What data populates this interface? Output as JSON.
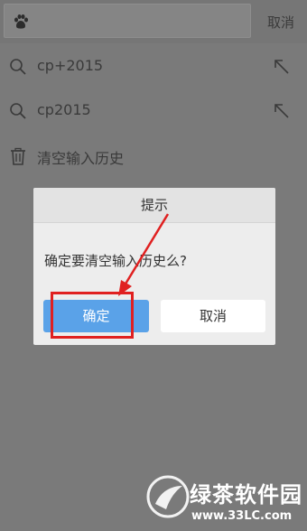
{
  "header": {
    "cancel_label": "取消"
  },
  "history": [
    {
      "text": "cp+2015"
    },
    {
      "text": "cp2015"
    }
  ],
  "clear_history_label": "清空输入历史",
  "dialog": {
    "title": "提示",
    "message": "确定要清空输入历史么?",
    "confirm_label": "确定",
    "cancel_label": "取消"
  },
  "watermark": {
    "name": "绿茶软件园",
    "url": "www.33LC.com"
  },
  "colors": {
    "confirm": "#5aa2e8",
    "highlight": "#e02020"
  },
  "icons": [
    "baidu-paw-icon",
    "search-icon",
    "fill-arrow-icon",
    "trash-icon"
  ]
}
